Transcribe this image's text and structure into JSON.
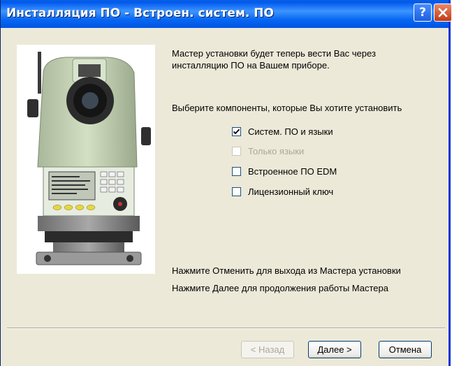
{
  "window": {
    "title": "Инсталляция ПО - Встроен. систем. ПО",
    "help_label": "?"
  },
  "intro": {
    "line1": "Мастер установки будет теперь вести Вас через",
    "line2": "инсталляцию ПО на Вашем приборе."
  },
  "components_prompt": "Выберите компоненты, которые Вы хотите установить",
  "components": [
    {
      "label": "Систем. ПО и языки",
      "checked": true,
      "enabled": true
    },
    {
      "label": "Только языки",
      "checked": false,
      "enabled": false
    },
    {
      "label": "Встроенное ПО EDM",
      "checked": false,
      "enabled": true
    },
    {
      "label": "Лицензионный ключ",
      "checked": false,
      "enabled": true
    }
  ],
  "hints": {
    "cancel_hint": "Нажмите Отменить для выхода из Мастера установки",
    "next_hint": "Нажмите Далее для продолжения работы Мастера"
  },
  "buttons": {
    "back": "< Назад",
    "next": "Далее >",
    "cancel": "Отмена"
  },
  "colors": {
    "titlebar": "#0054e3",
    "dialog_bg": "#ece9d8",
    "instrument_body": "#c9d7b8"
  }
}
